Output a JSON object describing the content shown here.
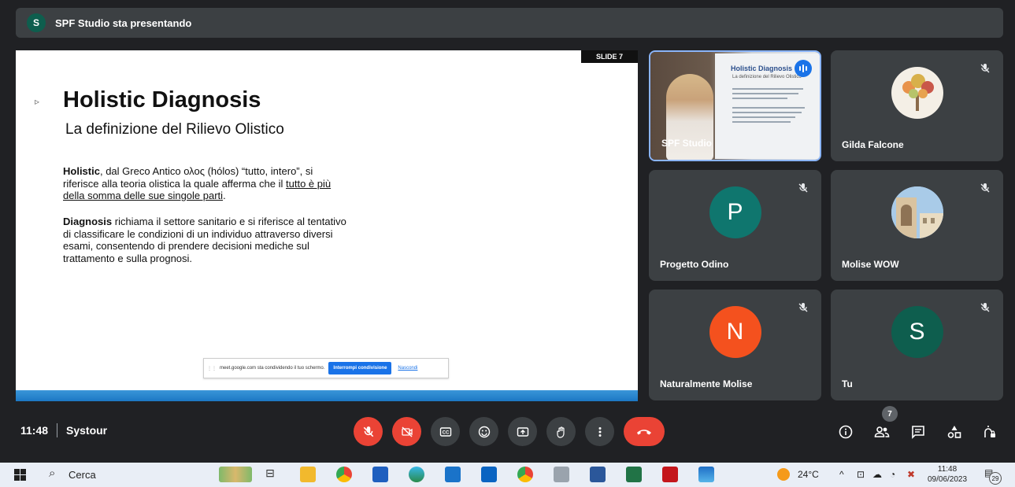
{
  "presenting_bar": {
    "avatar_letter": "S",
    "text": "SPF Studio sta presentando"
  },
  "slide": {
    "tag": "SLIDE 7",
    "title": "Holistic Diagnosis",
    "subtitle": "La definizione del Rilievo Olistico",
    "p1_bold": "Holistic",
    "p1_text": ", dal Greco Antico ολος (hólos) “tutto, intero”, si riferisce alla teoria olistica la quale afferma che il ",
    "p1_underlined": "tutto è più della somma delle sue singole parti",
    "p1_end": ".",
    "p2_bold": "Diagnosis",
    "p2_text": " richiama il settore sanitario e si riferisce al tentativo di classificare le condizioni di un individuo attraverso diversi esami, consentendo di prendere decisioni mediche sul trattamento e sulla prognosi.",
    "share_bar": {
      "text": "meet.google.com sta condividendo il tuo schermo.",
      "stop_label": "Interrompi condivisione",
      "hide_label": "Nascondi"
    }
  },
  "tiles": [
    {
      "name": "SPF Studio",
      "type": "video",
      "speaking": true,
      "screen_title": "Holistic Diagnosis",
      "screen_subtitle": "La definizione del Rilievo Olistico"
    },
    {
      "name": "Gilda Falcone",
      "type": "photo",
      "muted": true
    },
    {
      "name": "Progetto Odino",
      "type": "letter",
      "letter": "P",
      "color": "#0f766e",
      "muted": true
    },
    {
      "name": "Molise WOW",
      "type": "photo",
      "muted": true
    },
    {
      "name": "Naturalmente Molise",
      "type": "letter",
      "letter": "N",
      "color": "#f4511e",
      "muted": true
    },
    {
      "name": "Tu",
      "type": "letter",
      "letter": "S",
      "color": "#0e5e4e",
      "muted": true
    }
  ],
  "controls": {
    "time": "11:48",
    "meeting_name": "Systour",
    "people_count": "7",
    "icons": [
      "mic-off-icon",
      "camera-off-icon",
      "captions-icon",
      "emoji-icon",
      "present-icon",
      "raise-hand-icon",
      "more-icon",
      "end-call-icon",
      "info-icon",
      "people-icon",
      "chat-icon",
      "activities-icon",
      "host-controls-icon"
    ]
  },
  "taskbar": {
    "search_label": "Cerca",
    "weather": "24°C",
    "time": "11:48",
    "date": "09/06/2023",
    "notifications": "29"
  }
}
